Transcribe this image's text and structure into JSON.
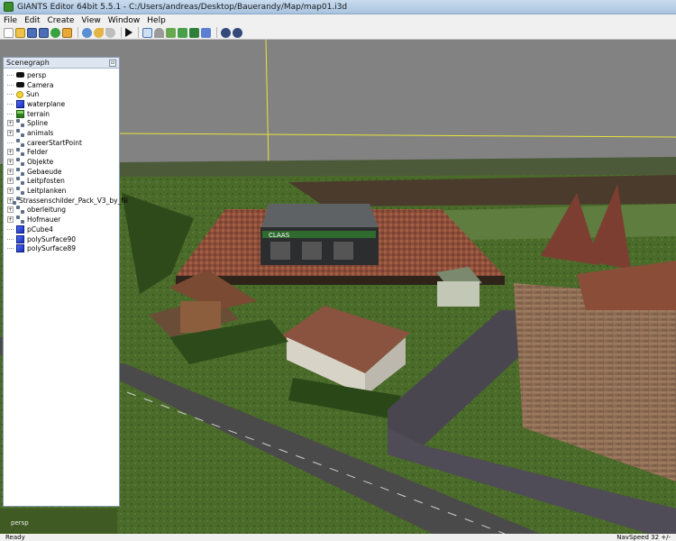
{
  "window": {
    "title": "GIANTS Editor 64bit 5.5.1 - C:/Users/andreas/Desktop/Bauerandy/Map/map01.i3d"
  },
  "menu": [
    "File",
    "Edit",
    "Create",
    "View",
    "Window",
    "Help"
  ],
  "toolbar": {
    "buttons": [
      "new-file",
      "open-file",
      "save-file",
      "save-as",
      "reload",
      "import",
      "cut",
      "undo",
      "redo",
      "play",
      "select-tool",
      "magnet-tool",
      "terrain-tool",
      "paint-tool",
      "foliage-tool",
      "decoration-tool",
      "settings",
      "network"
    ]
  },
  "scenegraph": {
    "title": "Scenegraph",
    "items": [
      {
        "label": "persp",
        "icon": "camera-icon",
        "expandable": false
      },
      {
        "label": "Camera",
        "icon": "camera-icon",
        "expandable": false
      },
      {
        "label": "Sun",
        "icon": "sun-icon",
        "expandable": false
      },
      {
        "label": "waterplane",
        "icon": "cube-icon",
        "expandable": false
      },
      {
        "label": "terrain",
        "icon": "terrain-icon",
        "expandable": false
      },
      {
        "label": "Spline",
        "icon": "group-icon",
        "expandable": true
      },
      {
        "label": "animals",
        "icon": "group-icon",
        "expandable": true
      },
      {
        "label": "careerStartPoint",
        "icon": "group-icon",
        "expandable": false
      },
      {
        "label": "Felder",
        "icon": "group-icon",
        "expandable": true
      },
      {
        "label": "Objekte",
        "icon": "group-icon",
        "expandable": true
      },
      {
        "label": "Gebaeude",
        "icon": "group-icon",
        "expandable": true
      },
      {
        "label": "Leitpfosten",
        "icon": "group-icon",
        "expandable": true
      },
      {
        "label": "Leitplanken",
        "icon": "group-icon",
        "expandable": true
      },
      {
        "label": "Strassenschilder_Pack_V3_by_Ni",
        "icon": "group-icon",
        "expandable": true
      },
      {
        "label": "oberleitung",
        "icon": "group-icon",
        "expandable": true
      },
      {
        "label": "Hofmauer",
        "icon": "group-icon",
        "expandable": true
      },
      {
        "label": "pCube4",
        "icon": "cube-icon",
        "expandable": false
      },
      {
        "label": "polySurface90",
        "icon": "cube-icon",
        "expandable": false
      },
      {
        "label": "polySurface89",
        "icon": "cube-icon",
        "expandable": false
      }
    ]
  },
  "viewport": {
    "camera_label": "persp",
    "building_sign": "CLAAS"
  },
  "status": {
    "left": "Ready",
    "right": "NavSpeed 32 +/-"
  },
  "colors": {
    "sky": "#828282",
    "grass": "#3f5a22",
    "road": "#4a4a4a",
    "tile": "#a35a3c"
  }
}
